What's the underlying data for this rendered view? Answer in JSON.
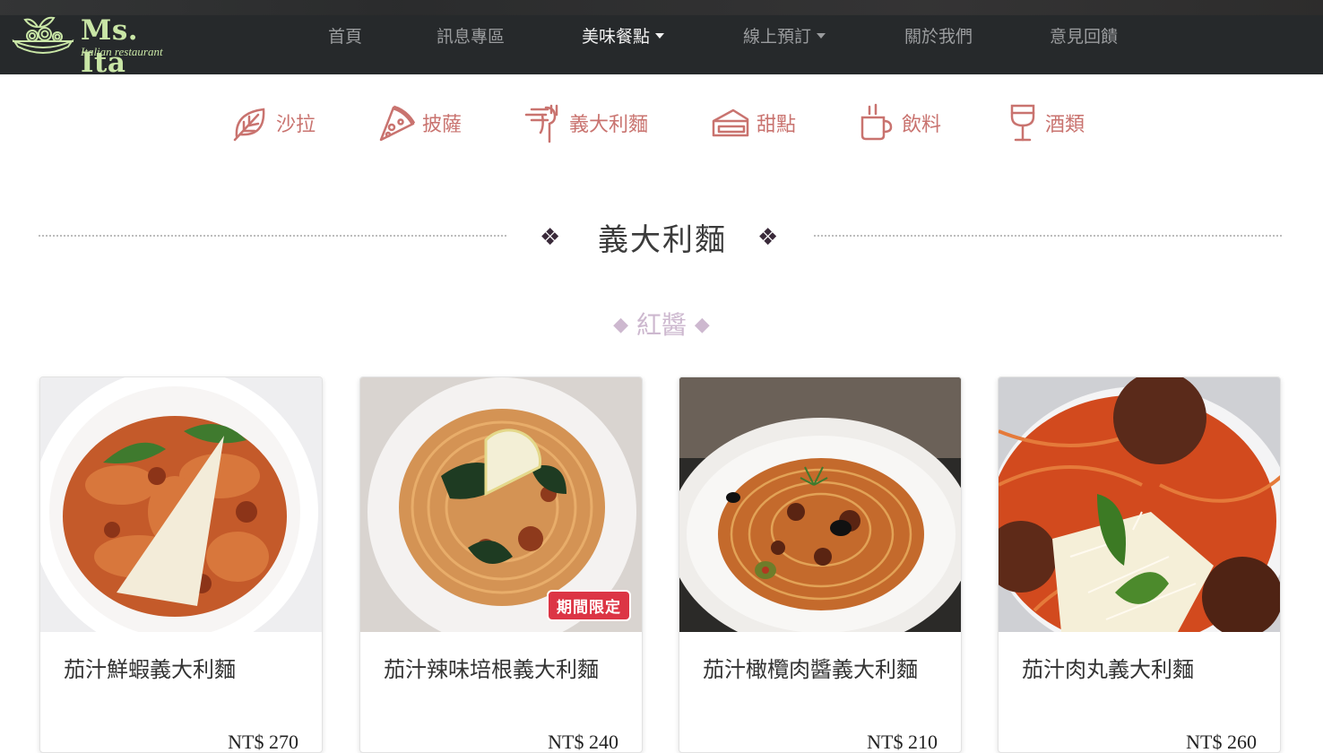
{
  "brand": {
    "name": "Ms. Ita",
    "subtitle": "Italian restaurant",
    "color": "#c9e6a6"
  },
  "nav": {
    "items": [
      {
        "label": "首頁",
        "dropdown": false,
        "active": false
      },
      {
        "label": "訊息專區",
        "dropdown": false,
        "active": false
      },
      {
        "label": "美味餐點",
        "dropdown": true,
        "active": true
      },
      {
        "label": "線上預訂",
        "dropdown": true,
        "active": false
      },
      {
        "label": "關於我們",
        "dropdown": false,
        "active": false
      },
      {
        "label": "意見回饋",
        "dropdown": false,
        "active": false
      }
    ]
  },
  "categories": [
    {
      "label": "沙拉",
      "icon": "leaf-icon"
    },
    {
      "label": "披薩",
      "icon": "pizza-icon"
    },
    {
      "label": "義大利麵",
      "icon": "fork-pasta-icon"
    },
    {
      "label": "甜點",
      "icon": "cake-icon"
    },
    {
      "label": "飲料",
      "icon": "coffee-cup-icon"
    },
    {
      "label": "酒類",
      "icon": "wine-glass-icon"
    }
  ],
  "section": {
    "title": "義大利麵",
    "ornament": "❖"
  },
  "subsection": {
    "title": "紅醬",
    "ornament": "◆"
  },
  "cards": [
    {
      "title": "茄汁鮮蝦義大利麵",
      "price": "NT$ 270",
      "badge": ""
    },
    {
      "title": "茄汁辣味培根義大利麵",
      "price": "NT$ 240",
      "badge": "期間限定"
    },
    {
      "title": "茄汁橄欖肉醬義大利麵",
      "price": "NT$ 210",
      "badge": ""
    },
    {
      "title": "茄汁肉丸義大利麵",
      "price": "NT$ 260",
      "badge": ""
    }
  ],
  "colors": {
    "accent": "#c9736f",
    "navbar": "#26292b",
    "badge": "#dc3545",
    "subtitle": "#cdb8cf"
  }
}
